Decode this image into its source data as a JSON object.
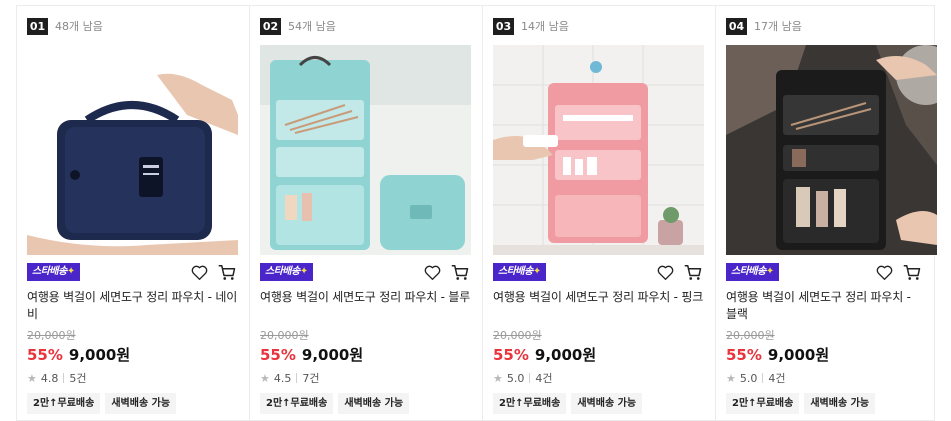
{
  "products": [
    {
      "rank": "01",
      "stock": "48개 남음",
      "badge": "스타배송",
      "badge_star": "✦",
      "title": "여행용 벽걸이 세면도구 정리 파우치 - 네이비",
      "original_price": "20,000원",
      "discount": "55%",
      "price": "9,000원",
      "rating": "4.8",
      "reviews": "5건",
      "tags": [
        "2만↑무료배송",
        "새벽배송 가능"
      ],
      "color": "#1e2a4d"
    },
    {
      "rank": "02",
      "stock": "54개 남음",
      "badge": "스타배송",
      "badge_star": "✦",
      "title": "여행용 벽걸이 세면도구 정리 파우치 - 블루",
      "original_price": "20,000원",
      "discount": "55%",
      "price": "9,000원",
      "rating": "4.5",
      "reviews": "7건",
      "tags": [
        "2만↑무료배송",
        "새벽배송 가능"
      ],
      "color": "#8fd3d3"
    },
    {
      "rank": "03",
      "stock": "14개 남음",
      "badge": "스타배송",
      "badge_star": "✦",
      "title": "여행용 벽걸이 세면도구 정리 파우치 - 핑크",
      "original_price": "20,000원",
      "discount": "55%",
      "price": "9,000원",
      "rating": "5.0",
      "reviews": "4건",
      "tags": [
        "2만↑무료배송",
        "새벽배송 가능"
      ],
      "color": "#f09ba1"
    },
    {
      "rank": "04",
      "stock": "17개 남음",
      "badge": "스타배송",
      "badge_star": "✦",
      "title": "여행용 벽걸이 세면도구 정리 파우치 - 블랙",
      "original_price": "20,000원",
      "discount": "55%",
      "price": "9,000원",
      "rating": "5.0",
      "reviews": "4건",
      "tags": [
        "2만↑무료배송",
        "새벽배송 가능"
      ],
      "color": "#1b1b1b"
    }
  ],
  "icons": {
    "wishlist": "heart-icon",
    "cart": "cart-icon",
    "rating": "star-icon"
  },
  "colors": {
    "discount": "#e8343d",
    "badge": "#4a25c9",
    "rank_bg": "#1f1f1f"
  }
}
